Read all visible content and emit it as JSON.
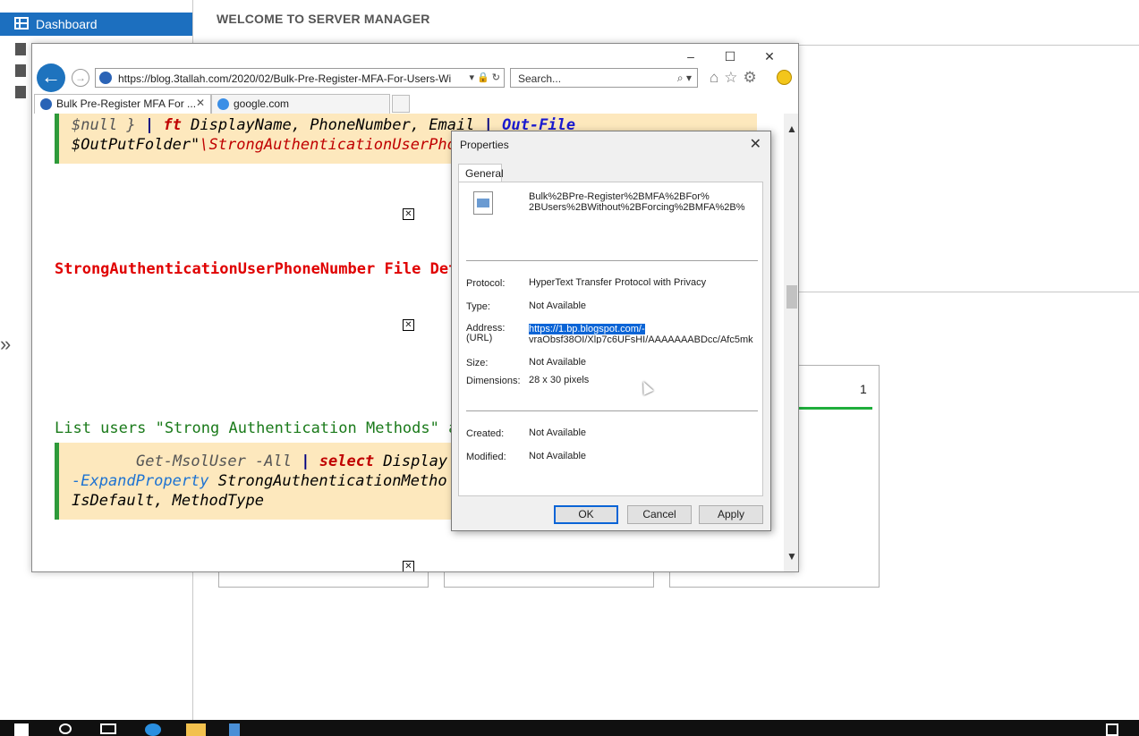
{
  "server_manager": {
    "nav_selected": "Dashboard",
    "welcome": "WELCOME TO SERVER MANAGER",
    "tile_count": "1"
  },
  "browser": {
    "url": "https://blog.3tallah.com/2020/02/Bulk-Pre-Register-MFA-For-Users-Wi",
    "search_placeholder": "Search...",
    "tabs": [
      {
        "label": "Bulk Pre-Register MFA For ..."
      },
      {
        "label": "google.com"
      }
    ],
    "content": {
      "code1_line1_a": "$null }",
      "code1_line1_b": "|",
      "code1_line1_c": "ft",
      "code1_line1_d": "DisplayName, PhoneNumber, Email",
      "code1_line1_e": "|",
      "code1_line1_f": "Out-File",
      "code1_line2_a": "$OutPutFolder\"",
      "code1_line2_b": "\\StrongAuthenticationUserPho",
      "red_heading": "StrongAuthenticationUserPhoneNumber File Det",
      "green_heading": "List users \"Strong Authentication Methods\" a",
      "code2_line1_a": "Get-MsolUser -All",
      "code2_line1_b": "|",
      "code2_line1_c": "select",
      "code2_line1_d": "Display",
      "code2_line2_a": "-ExpandProperty",
      "code2_line2_b": "StrongAuthenticationMetho",
      "code2_line3": "IsDefault, MethodType"
    }
  },
  "properties_dialog": {
    "title": "Properties",
    "tab": "General",
    "filename": "Bulk%2BPre-Register%2BMFA%2BFor% 2BUsers%2BWithout%2BForcing%2BMFA%2B%",
    "protocol_label": "Protocol:",
    "protocol_value": "HyperText Transfer Protocol with Privacy",
    "type_label": "Type:",
    "type_value": "Not Available",
    "address_label": "Address:",
    "address_label2": "(URL)",
    "address_selected": "https://1.bp.blogspot.com/-",
    "address_rest": "vraObsf38OI/Xlp7c6UFsHI/AAAAAAABDcc/Afc5mk",
    "size_label": "Size:",
    "size_value": "Not Available",
    "dimensions_label": "Dimensions:",
    "dimensions_value": "28  x  30  pixels",
    "created_label": "Created:",
    "created_value": "Not Available",
    "modified_label": "Modified:",
    "modified_value": "Not Available",
    "ok": "OK",
    "cancel": "Cancel",
    "apply": "Apply"
  }
}
